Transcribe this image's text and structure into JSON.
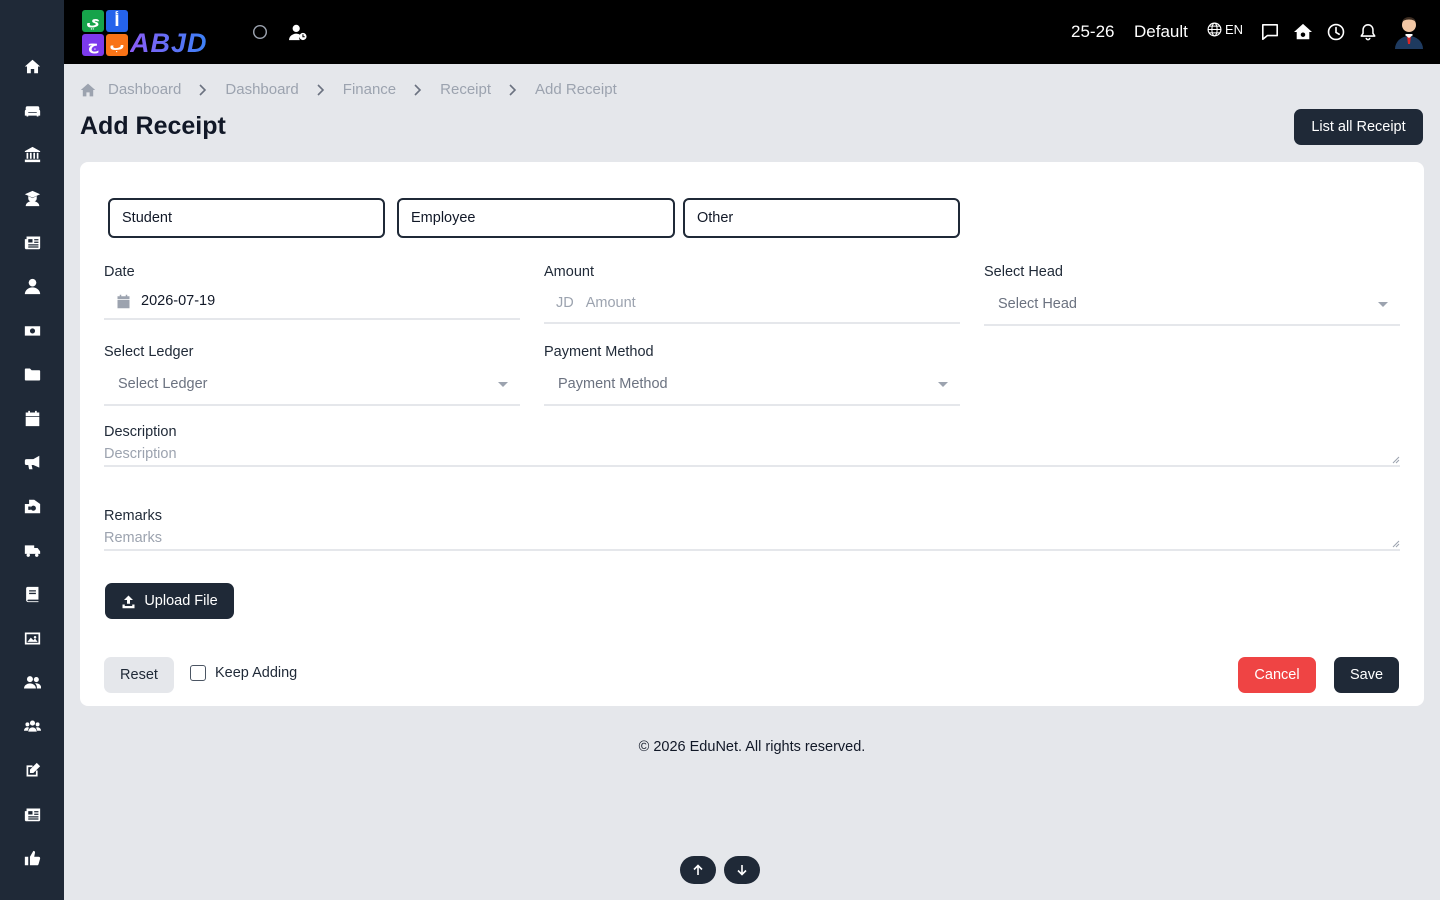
{
  "brand": {
    "logo_text": "ABJD",
    "logo_tiles": [
      "ي",
      "أ",
      "ج",
      "ب"
    ],
    "colors": {
      "tile_green": "#16a34a",
      "tile_blue": "#2563eb",
      "tile_purple": "#7c3aed",
      "tile_orange": "#f97316",
      "text_purple": "#8b5cf6",
      "text_blue": "#3b82f6"
    }
  },
  "sidebar": {
    "items": [
      {
        "icon": "home-icon"
      },
      {
        "icon": "sofa-icon"
      },
      {
        "icon": "bank-icon"
      },
      {
        "icon": "graduate-icon"
      },
      {
        "icon": "newspaper-icon"
      },
      {
        "icon": "user-tie-icon"
      },
      {
        "icon": "money-icon"
      },
      {
        "icon": "folder-icon"
      },
      {
        "icon": "calendar-icon"
      },
      {
        "icon": "megaphone-icon"
      },
      {
        "icon": "school-icon"
      },
      {
        "icon": "truck-icon"
      },
      {
        "icon": "book-icon"
      },
      {
        "icon": "image-icon"
      },
      {
        "icon": "users-icon"
      },
      {
        "icon": "group-icon"
      },
      {
        "icon": "edit-icon"
      },
      {
        "icon": "newspaper-icon"
      },
      {
        "icon": "thumbs-up-icon"
      }
    ]
  },
  "topbar": {
    "session": "25-26",
    "profile": "Default",
    "language": "EN"
  },
  "breadcrumb": [
    "Dashboard",
    "Dashboard",
    "Finance",
    "Receipt",
    "Add Receipt"
  ],
  "page": {
    "title": "Add Receipt",
    "list_button": "List all Receipt"
  },
  "form": {
    "types": [
      "Student",
      "Employee",
      "Other"
    ],
    "date": {
      "label": "Date",
      "value": "2026-07-19"
    },
    "amount": {
      "label": "Amount",
      "prefix": "JD",
      "placeholder": "Amount"
    },
    "head": {
      "label": "Select Head",
      "placeholder": "Select Head"
    },
    "ledger": {
      "label": "Select Ledger",
      "placeholder": "Select Ledger"
    },
    "payment": {
      "label": "Payment Method",
      "placeholder": "Payment Method"
    },
    "description": {
      "label": "Description",
      "placeholder": "Description"
    },
    "remarks": {
      "label": "Remarks",
      "placeholder": "Remarks"
    },
    "upload_label": "Upload File",
    "reset_label": "Reset",
    "keep_adding_label": "Keep Adding",
    "keep_adding_checked": false,
    "cancel_label": "Cancel",
    "save_label": "Save"
  },
  "footer": {
    "text": "© 2026 EduNet. All rights reserved."
  }
}
